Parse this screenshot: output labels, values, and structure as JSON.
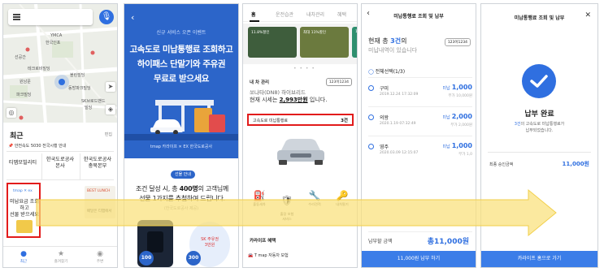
{
  "colors": {
    "brand_blue": "#2f6fe0",
    "event_blue": "#2c65c9",
    "highlight_red": "#e21b1b",
    "arrow_yellow": "#f9e07a"
  },
  "panel1": {
    "map_labels": [
      "YMCA",
      "한국인포",
      "선공간",
      "테크로비빌딩",
      "원남문",
      "블린빌딩",
      "동방파크빌딩",
      "파크빌딩",
      "SK브로드밴드",
      "빌딩"
    ],
    "recent_title": "최근",
    "edit_label": "편집",
    "notice": "안전속도 5030 전국시행 안내",
    "grid": [
      "티맵모빌리티",
      "한국도로공사\n본사",
      "한국도로공사\n충북본부"
    ],
    "tile_logo": "tmap ✕ ex",
    "tile_text": "미납요금 조회하고\n선물 받으세요",
    "tile2_logo": "BEST LUNCH",
    "tile2_text": "배달은 티맵에서",
    "nav": [
      {
        "icon": "●",
        "label": "최근"
      },
      {
        "icon": "★",
        "label": "즐겨찾기"
      },
      {
        "icon": "◉",
        "label": "주변"
      }
    ]
  },
  "panel2": {
    "kicker": "신규 서비스 오픈 이벤트",
    "headline": [
      "고속도로 미납통행료 조회하고",
      "하이패스 단말기와 주유권",
      "무료로 받으세요"
    ],
    "brand": "tmap 카라이프 ✕ EX 한국도로공사",
    "pill": "선물 안내",
    "body1": "조건 달성 시, 총 ",
    "body_bold": "400명",
    "body2": "의 고객님께",
    "body_line2": "선물 1가지를 추첨하여 드립니다.",
    "sub": "(한국도로공사 제공)",
    "badge1": "100",
    "badge2": "300",
    "gift_card": "SK 주유권\n3만원"
  },
  "panel3": {
    "tabs": [
      "홈",
      "운전습관",
      "내차관리",
      "혜택"
    ],
    "coupons": [
      "11.8%할인",
      "최대 11%할인",
      "10"
    ],
    "section": "내 차 관리",
    "plate": "123이1234",
    "car_name": "쏘나타(DN8) 하이브리드",
    "value_prefix": "현재 시세는 ",
    "value": "2,993만원",
    "value_suffix": " 입니다.",
    "unpaid_label": "고속도로 미납통행료",
    "unpaid_count": "3건",
    "services": [
      {
        "icon": "⛽",
        "label": "출동세차"
      },
      {
        "icon": "🛡",
        "label": "출장 보험\n서비스"
      },
      {
        "icon": "🔧",
        "label": "수리견적"
      },
      {
        "icon": "🔑",
        "label": "내차팔기"
      }
    ],
    "benefit_title": "카라이프 혜택",
    "benefit_row": "T map 자동차 보험"
  },
  "panel4": {
    "title": "미납통행료 조회 및 납부",
    "total_pre": "현재 총 ",
    "total_count": "3건",
    "total_post": "의",
    "sub": "미납내역이 있습니다",
    "plate": "123이1234",
    "select_all": "전체선택(1/3)",
    "rows": [
      {
        "name": "구미",
        "date": "2019.12.24 17:32:09",
        "tag": "미납",
        "amount": "1,000",
        "sub": "부가 10,000원"
      },
      {
        "name": "의왕",
        "date": "2020.1.19 07:32:49",
        "tag": "미납",
        "amount": "2,000",
        "sub": "부가 2,000원"
      },
      {
        "name": "영주",
        "date": "2020.03.09 12:15:07",
        "tag": "미납",
        "amount": "1,000",
        "sub": "부가 1,0"
      }
    ],
    "pay_label": "납부할 금액",
    "pay_amount": "총11,000원",
    "pay_button": "11,000원 납부 하기"
  },
  "panel5": {
    "title": "미납통행료 조회 및 납부",
    "done": "납부 완료",
    "msg_hl": "3건",
    "msg_rest": "의 고속도로 미납통행료가",
    "msg_line2": "납부되었습니다.",
    "final_label": "최종 승인금액",
    "final_amount": "11,000원",
    "home_button": "카라이프 홈으로 가기"
  }
}
